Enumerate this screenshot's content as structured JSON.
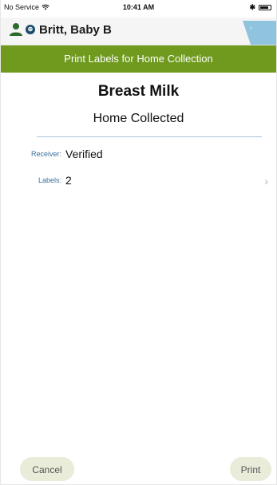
{
  "status_bar": {
    "carrier": "No Service",
    "time": "10:41 AM",
    "bluetooth": "✱"
  },
  "patient": {
    "name": "Britt, Baby B",
    "gender_glyph": "⊕"
  },
  "header": {
    "title": "Print Labels for Home Collection"
  },
  "content": {
    "title": "Breast Milk",
    "subtitle": "Home Collected",
    "rows": [
      {
        "label": "Receiver:",
        "value": "Verified"
      },
      {
        "label": "Labels:",
        "value": "2",
        "chevron": "›"
      }
    ]
  },
  "footer": {
    "cancel_label": "Cancel",
    "print_label": "Print"
  },
  "colors": {
    "accent_green": "#6f9a1e",
    "label_blue": "#3a6f9c",
    "button_bg": "#e9ecd9",
    "flag_blue": "#8fc3de"
  }
}
